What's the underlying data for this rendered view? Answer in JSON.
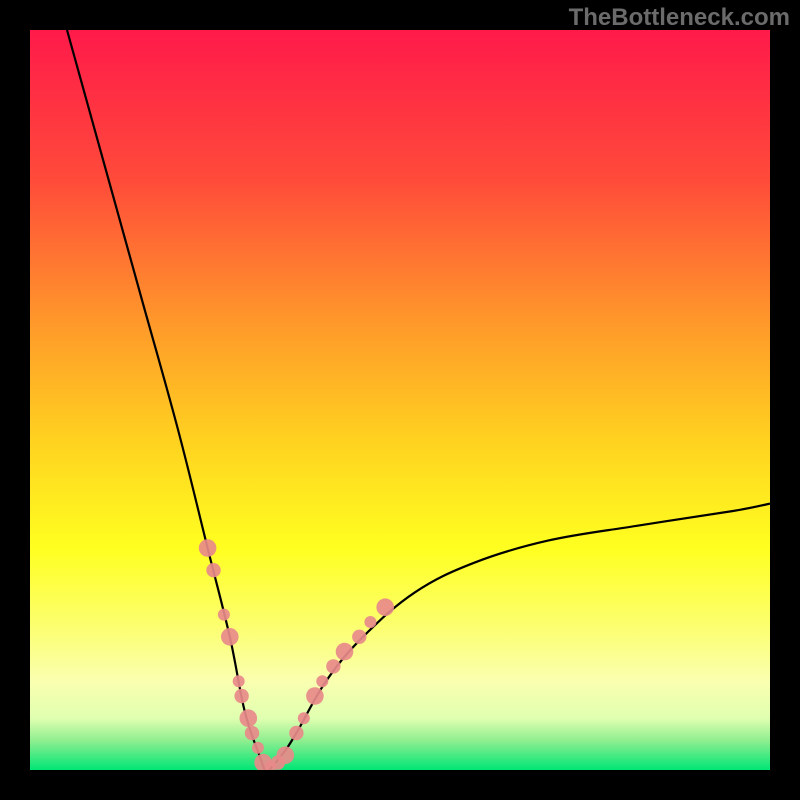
{
  "watermark": "TheBottleneck.com",
  "chart_data": {
    "type": "line",
    "title": "",
    "xlabel": "",
    "ylabel": "",
    "xlim": [
      0,
      100
    ],
    "ylim": [
      0,
      100
    ],
    "gradient_stops": [
      {
        "offset": 0,
        "color": "#ff1a4a"
      },
      {
        "offset": 20,
        "color": "#ff4a3a"
      },
      {
        "offset": 40,
        "color": "#ff9a2a"
      },
      {
        "offset": 55,
        "color": "#ffd020"
      },
      {
        "offset": 70,
        "color": "#ffff20"
      },
      {
        "offset": 80,
        "color": "#fcff6a"
      },
      {
        "offset": 88,
        "color": "#faffb0"
      },
      {
        "offset": 93,
        "color": "#e0ffb0"
      },
      {
        "offset": 96,
        "color": "#90ee90"
      },
      {
        "offset": 100,
        "color": "#00e676"
      }
    ],
    "curve": {
      "note": "V-shaped bottleneck curve; minimum (0%) at x≈32, rising steeply left toward 100 and gently right toward ~35",
      "min_x": 32,
      "left_branch_x": [
        5,
        10,
        15,
        20,
        24,
        27,
        29,
        31,
        32
      ],
      "left_branch_y": [
        100,
        82,
        64,
        46,
        30,
        18,
        8,
        2,
        0
      ],
      "right_branch_x": [
        32,
        34,
        36,
        40,
        45,
        52,
        60,
        70,
        82,
        95,
        100
      ],
      "right_branch_y": [
        0,
        2,
        5,
        12,
        18,
        24,
        28,
        31,
        33,
        35,
        36
      ]
    },
    "markers": {
      "color": "#e88a8a",
      "radius_range": [
        6,
        10
      ],
      "points": [
        {
          "x": 24.0,
          "y": 30
        },
        {
          "x": 24.8,
          "y": 27
        },
        {
          "x": 26.2,
          "y": 21
        },
        {
          "x": 27.0,
          "y": 18
        },
        {
          "x": 28.2,
          "y": 12
        },
        {
          "x": 28.6,
          "y": 10
        },
        {
          "x": 29.5,
          "y": 7
        },
        {
          "x": 30.0,
          "y": 5
        },
        {
          "x": 30.8,
          "y": 3
        },
        {
          "x": 31.5,
          "y": 1
        },
        {
          "x": 32.5,
          "y": 0.5
        },
        {
          "x": 33.5,
          "y": 1
        },
        {
          "x": 34.5,
          "y": 2
        },
        {
          "x": 36.0,
          "y": 5
        },
        {
          "x": 37.0,
          "y": 7
        },
        {
          "x": 38.5,
          "y": 10
        },
        {
          "x": 39.5,
          "y": 12
        },
        {
          "x": 41.0,
          "y": 14
        },
        {
          "x": 42.5,
          "y": 16
        },
        {
          "x": 44.5,
          "y": 18
        },
        {
          "x": 46.0,
          "y": 20
        },
        {
          "x": 48.0,
          "y": 22
        }
      ]
    }
  }
}
